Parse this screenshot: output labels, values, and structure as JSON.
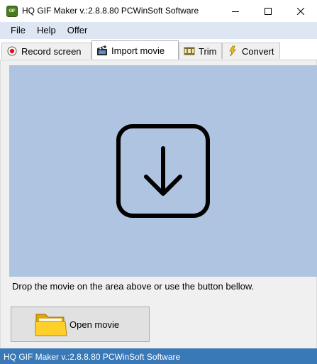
{
  "window": {
    "title": "HQ GIF Maker v.:2.8.8.80 PCWinSoft Software",
    "icon_text": "GIF"
  },
  "menu": {
    "items": [
      "File",
      "Help",
      "Offer"
    ]
  },
  "tabs": [
    {
      "label": "Record screen",
      "icon": "record-icon"
    },
    {
      "label": "Import movie",
      "icon": "film-icon"
    },
    {
      "label": "Trim",
      "icon": "trim-icon"
    },
    {
      "label": "Convert",
      "icon": "convert-icon"
    }
  ],
  "active_tab": "Import movie",
  "import": {
    "drop_icon": "download-arrow-icon",
    "hint": "Drop the movie on the area above or use the button bellow.",
    "open_button_label": "Open movie",
    "open_button_icon": "folder-icon"
  },
  "status": {
    "text": "HQ GIF Maker v.:2.8.8.80 PCWinSoft Software"
  },
  "colors": {
    "drop_area": "#aec4e0",
    "menubar": "#dde6f2",
    "statusbar": "#3a79b8",
    "record_dot": "#e01010"
  }
}
